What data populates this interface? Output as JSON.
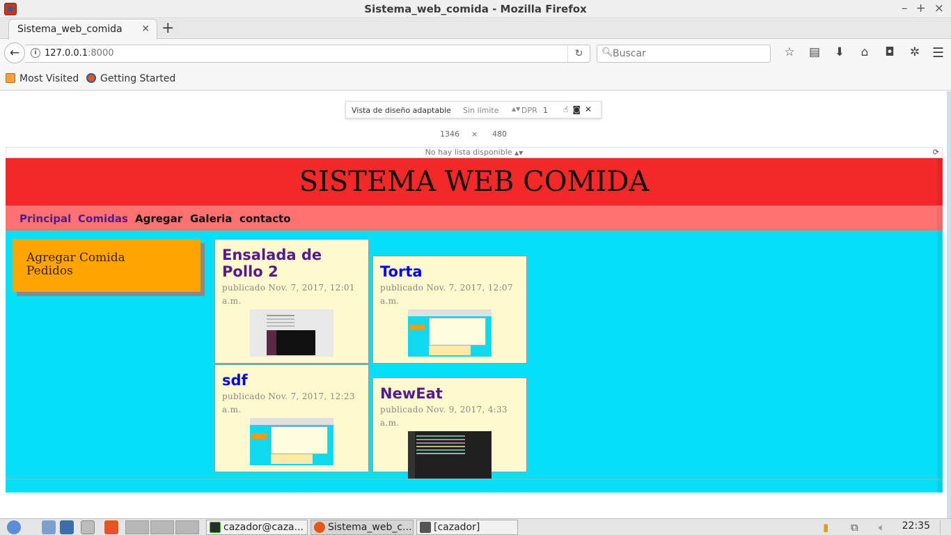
{
  "window": {
    "title": "Sistema_web_comida - Mozilla Firefox"
  },
  "tabs": [
    {
      "label": "Sistema_web_comida",
      "close": "×"
    }
  ],
  "new_tab": "+",
  "url": {
    "host": "127.0.0.1",
    "port": ":8000"
  },
  "search": {
    "placeholder": "Buscar"
  },
  "bookmarks": [
    {
      "label": "Most Visited"
    },
    {
      "label": "Getting Started"
    }
  ],
  "responsive_toolbar": {
    "title": "Vista de diseño adaptable",
    "device": "Sin límite",
    "dpr_label": "DPR",
    "dpr_value": "1",
    "width": "1346",
    "times": "×",
    "height": "480",
    "list_text": "No hay lista disponible"
  },
  "site": {
    "title": "SISTEMA WEB COMIDA",
    "nav": [
      "Principal",
      "Comidas",
      "Agregar",
      "Galeria",
      "contacto"
    ],
    "sidebar_links": [
      "Agregar Comida",
      "Pedidos"
    ],
    "posts": [
      {
        "title": "Ensalada de Pollo 2",
        "meta": "publicado Nov. 7, 2017, 12:01 a.m."
      },
      {
        "title": "Torta",
        "meta": "publicado Nov. 7, 2017, 12:07 a.m."
      },
      {
        "title": "sdf",
        "meta": "publicado Nov. 7, 2017, 12:23 a.m."
      },
      {
        "title": "NewEat",
        "meta": "publicado Nov. 9, 2017, 4:33 a.m."
      }
    ]
  },
  "colors": {
    "header": "#f22829",
    "nav": "#fe7171",
    "body": "#05dff7",
    "sidebar": "#ffa500",
    "card": "#fffacd",
    "visited_link": "#551a8b",
    "link": "#0000ee"
  },
  "taskbar": {
    "terminal": "cazador@caza...",
    "firefox": "Sistema_web_c...",
    "folder": "[cazador]",
    "clock": "22:35"
  }
}
